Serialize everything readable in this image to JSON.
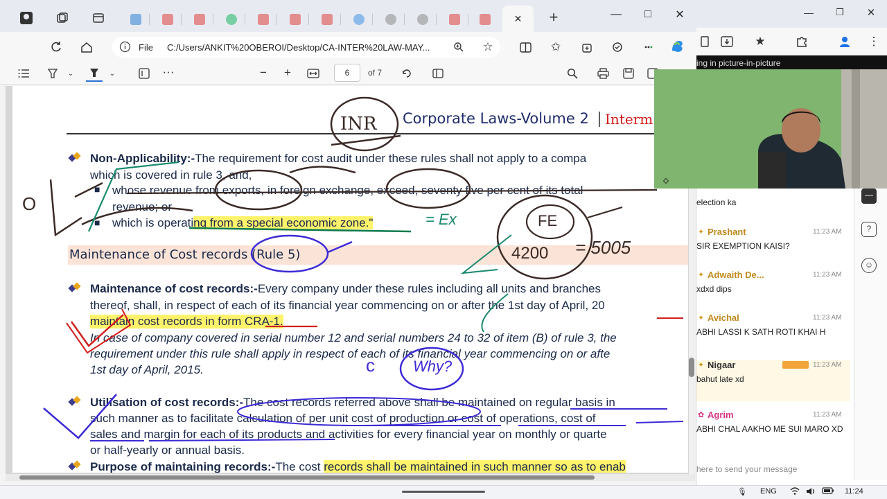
{
  "browser": {
    "tabs_count": 13,
    "active_tab_close": "×",
    "new_tab": "+",
    "window": {
      "minimize": "—",
      "maximize": "□",
      "close": "✕"
    },
    "address": {
      "file_label": "File",
      "url": "C:/Users/ANKIT%20OBEROI/Desktop/CA-INTER%20LAW-MAY..."
    }
  },
  "pdf_toolbar": {
    "page_number": "6",
    "page_of": "of 7"
  },
  "document": {
    "header_brand": "Corporate Laws-Volume 2",
    "header_sep": "|",
    "header_right": "Interm",
    "para1": {
      "heading": "Non-Applicability:-",
      "text1": "The requirement for cost audit under these rules shall not apply to a compa",
      "text2": "which is covered in rule 3, and,",
      "sub1": "whose revenue from exports, in foreign exchange, exceed, seventy five per cent of its total",
      "sub1b": "revenue; or",
      "sub2_pre": "which is operati",
      "sub2_hl": "ng from a special economic zone.\""
    },
    "section_title": "Maintenance of Cost records (Rule 5)",
    "para2": {
      "heading": "Maintenance of cost records:-",
      "text1": "Every company under these rules including all units and branches",
      "text2": "thereof, shall, in respect of each of its financial year commencing on or after the 1st day of April, 20",
      "text3_hl": "maintain cost records in form CRA-1.",
      "ital1": "In case of company covered in serial number 12 and serial numbers 24 to 32 of item (B) of rule 3, the",
      "ital2": "requirement under this rule shall apply in respect of each of its financial year commencing on or afte",
      "ital3": "1st day of April, 2015."
    },
    "para3": {
      "heading": "Utilisation of cost records:-",
      "text1": "The cost records referred above shall be maintained on regular basis in",
      "text2": "such manner as to facilitate calculation of per unit cost of production or cost of operations, cost of",
      "text3": "sales and margin for each of its products and activities for every financial year on monthly or quarte",
      "text4": "or half-yearly or annual basis."
    },
    "para4": {
      "heading": "Purpose of maintaining records:-",
      "text_pre": "The cost ",
      "text_hl": "records shall be maintained in such manner so as to enab"
    },
    "handwriting": {
      "circle_top": "INR",
      "marker_o": "O",
      "eq_ex": "= Ex",
      "fe": "FE",
      "fe_num": "4200",
      "fe_result": "= 5005",
      "c_mark": "c",
      "why": "Why?"
    }
  },
  "right_panel": {
    "banner": "ing in picture-in-picture",
    "chat_top_fragment": "election ka",
    "messages": [
      {
        "name": "Prashant",
        "time": "11:23 AM",
        "text": "SIR EXEMPTION KAISI?"
      },
      {
        "name": "Adwaith De...",
        "time": "11:23 AM",
        "text": "xdxd dips"
      },
      {
        "name": "Avichal",
        "time": "11:23 AM",
        "text": "ABHI LASSI K SATH ROTI KHAI H"
      },
      {
        "name": "Nigaar",
        "time": "11:23 AM",
        "text": "bahut late xd"
      },
      {
        "name": "Agrim",
        "time": "11:23 AM",
        "text": "ABHI CHAL AAKHO ME SUI MARO XD"
      }
    ],
    "input_placeholder": "here to send your message"
  },
  "taskbar": {
    "lang": "ENG",
    "clock": "11:24"
  }
}
